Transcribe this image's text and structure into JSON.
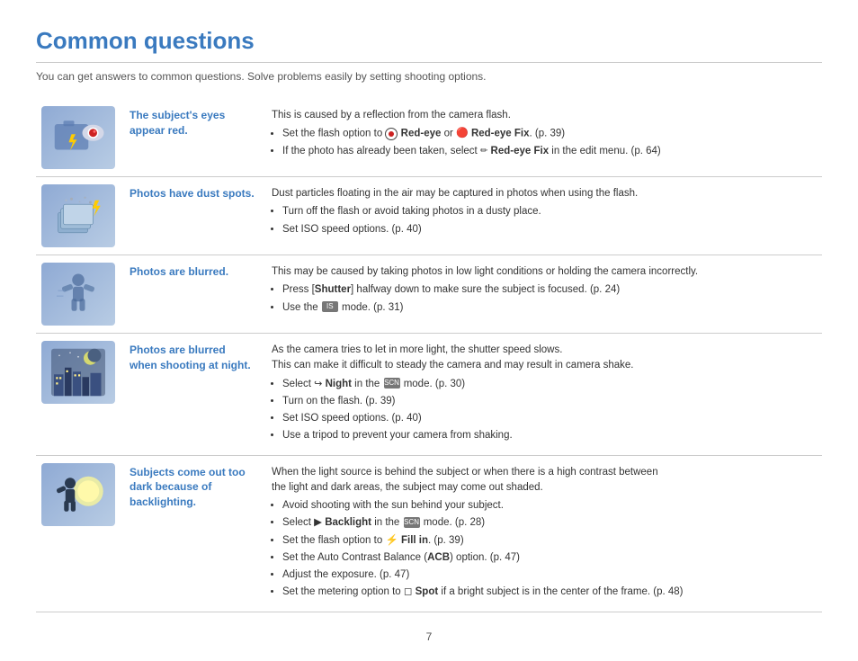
{
  "page": {
    "title": "Common questions",
    "subtitle": "You can get answers to common questions. Solve problems easily by setting shooting options.",
    "page_number": "7"
  },
  "rows": [
    {
      "id": "red-eye",
      "problem": "The subject's eyes appear red.",
      "icon_type": "red-eye",
      "solution_intro": "This is caused by a reflection from the camera flash.",
      "bullets": [
        "Set the flash option to ● Red-eye or ⚒ Red-eye Fix. (p. 39)",
        "If the photo has already been taken, select ⚒ Red-eye Fix in the edit menu. (p. 64)"
      ]
    },
    {
      "id": "dust",
      "problem": "Photos have dust spots.",
      "icon_type": "dust",
      "solution_intro": "Dust particles floating in the air may be captured in photos when using the flash.",
      "bullets": [
        "Turn off the flash or avoid taking photos in a dusty place.",
        "Set ISO speed options. (p. 40)"
      ]
    },
    {
      "id": "blurred",
      "problem": "Photos are blurred.",
      "icon_type": "blurred",
      "solution_intro": "This may be caused by taking photos in low light conditions or holding the camera incorrectly.",
      "bullets": [
        "Press [Shutter] halfway down to make sure the subject is focused. (p. 24)",
        "Use the ■ mode. (p. 31)"
      ]
    },
    {
      "id": "night",
      "problem": "Photos are blurred when shooting at night.",
      "icon_type": "night",
      "solution_intro": "As the camera tries to let in more light, the shutter speed slows.\nThis can make it difficult to steady the camera and may result in camera shake.",
      "bullets": [
        "Select ↪ Night in the ■ mode. (p. 30)",
        "Turn on the flash. (p. 39)",
        "Set ISO speed options. (p. 40)",
        "Use a tripod to prevent your camera from shaking."
      ]
    },
    {
      "id": "backlight",
      "problem": "Subjects come out too dark because of backlighting.",
      "icon_type": "backlight",
      "solution_intro": "When the light source is behind the subject or when there is a high contrast between\nthe light and dark areas, the subject may come out shaded.",
      "bullets": [
        "Avoid shooting with the sun behind your subject.",
        "Select ► Backlight in the ■ mode. (p. 28)",
        "Set the flash option to ⚡ Fill in. (p. 39)",
        "Set the Auto Contrast Balance (ACB) option. (p. 47)",
        "Adjust the exposure. (p. 47)",
        "Set the metering option to □ Spot if a bright subject is in the center of the frame. (p. 48)"
      ]
    }
  ]
}
